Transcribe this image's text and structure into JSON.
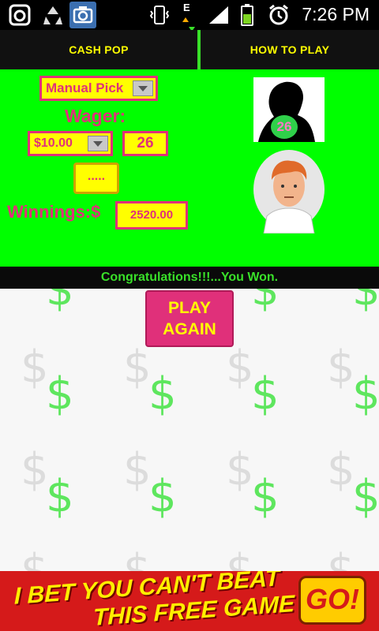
{
  "status_bar": {
    "time": "7:26 PM",
    "network_label": "E",
    "icons": [
      "instagram-icon",
      "recycle-icon",
      "camera-icon",
      "vibrate-icon",
      "data-arrows-icon",
      "signal-icon",
      "battery-icon",
      "alarm-icon"
    ]
  },
  "tabs": [
    {
      "label": "CASH POP"
    },
    {
      "label": "HOW TO PLAY"
    }
  ],
  "game": {
    "pick_mode": "Manual Pick",
    "wager_label": "Wager:",
    "wager_value": "$10.00",
    "picked_number": "26",
    "dots_button": ".....",
    "winnings_label": "Winnings:$",
    "winnings_value": "2520.00",
    "drawn_number": "26"
  },
  "message": "Congratulations!!!...You Won.",
  "play_again": {
    "line1": "PLAY",
    "line2": "AGAIN"
  },
  "ad": {
    "line1": "I BET YOU CAN'T BEAT",
    "line2": "THIS FREE GAME",
    "go": "GO!"
  },
  "colors": {
    "panel_green": "#00ff00",
    "accent_pink": "#e0307a",
    "field_yellow": "#ffff00",
    "ad_red": "#d51a1a"
  }
}
